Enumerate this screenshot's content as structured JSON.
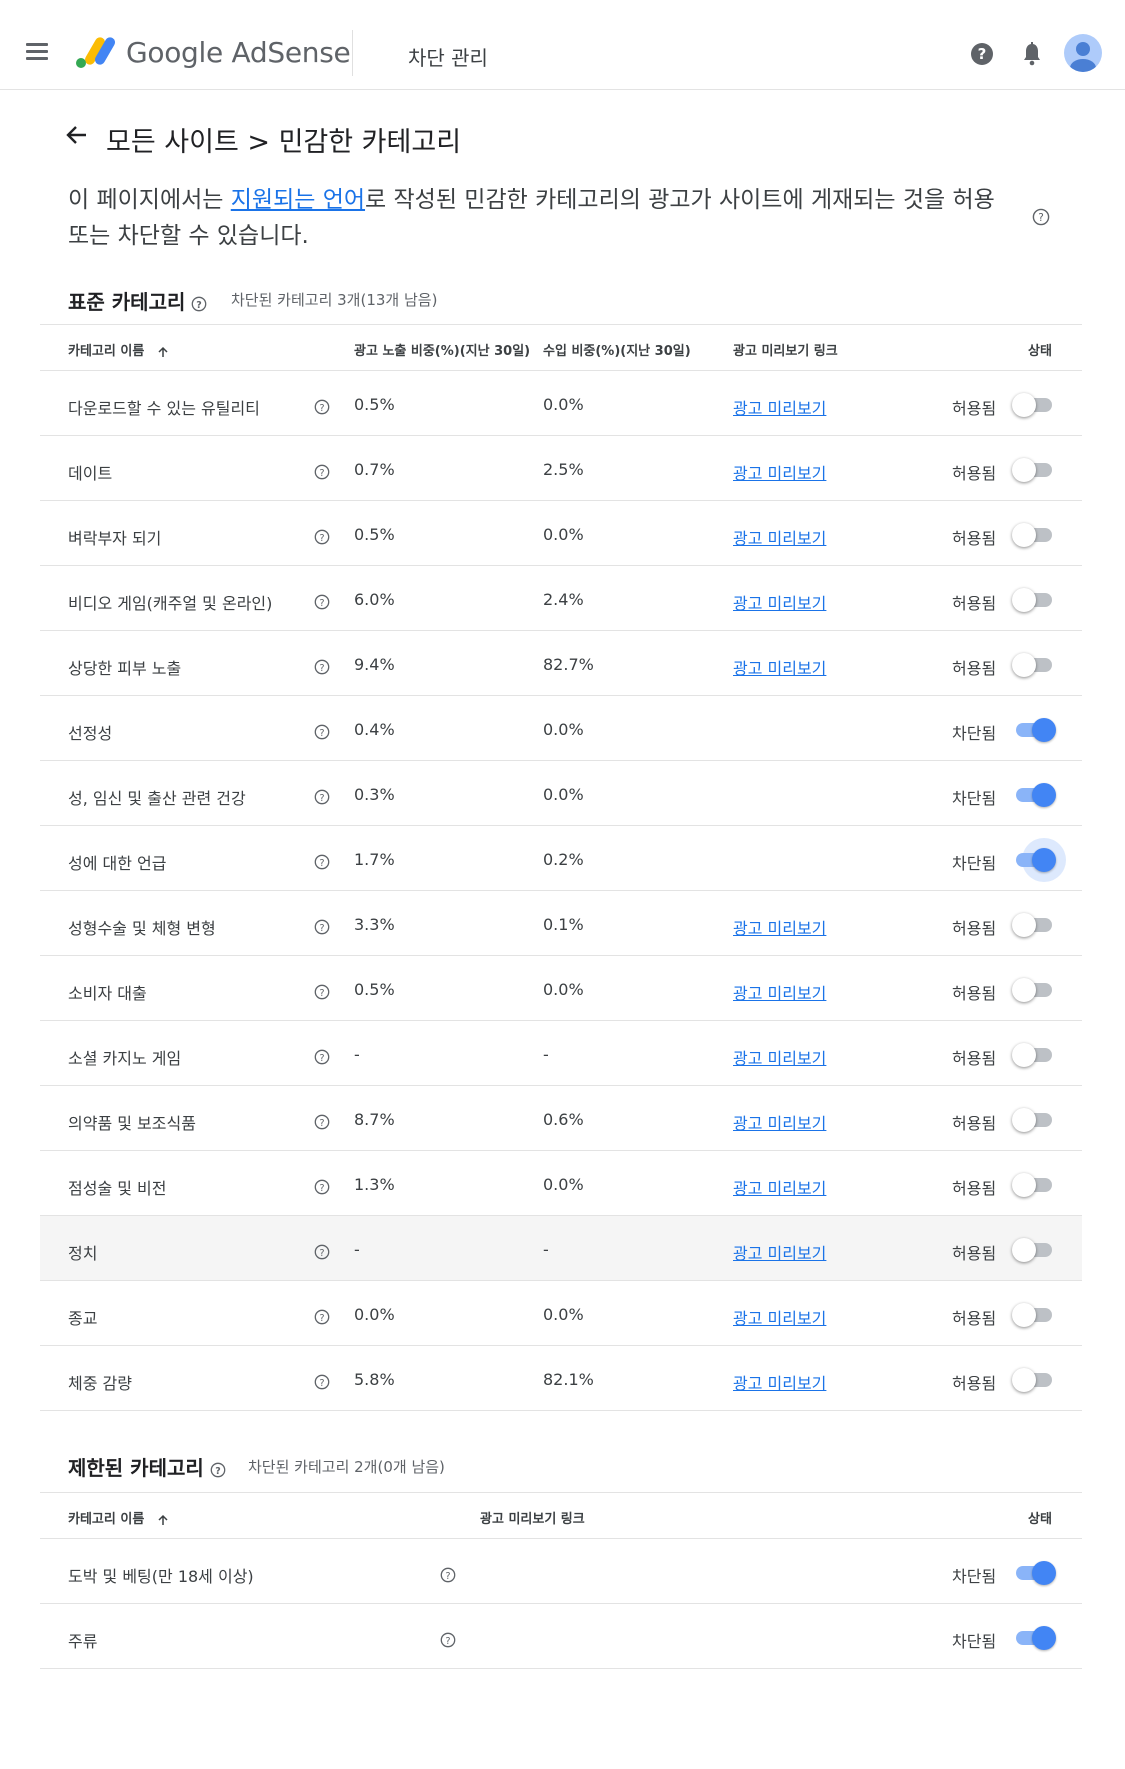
{
  "app": {
    "brand": "Google AdSense",
    "section_title": "차단 관리"
  },
  "breadcrumb": {
    "text": "모든 사이트 > 민감한 카테고리"
  },
  "description": {
    "before": "이 페이지에서는 ",
    "link": "지원되는 언어",
    "after": "로 작성된 민감한 카테고리의 광고가 사이트에 게재되는 것을 허용 또는 차단할 수 있습니다."
  },
  "standard": {
    "title": "표준 카테고리",
    "count": "차단된 카테고리 3개(13개 남음)",
    "headers": {
      "name": "카테고리 이름",
      "impressions": "광고 노출 비중(%)(지난 30일)",
      "revenue": "수입 비중(%)(지난 30일)",
      "preview": "광고 미리보기 링크",
      "status": "상태"
    },
    "rows": [
      {
        "name": "다운로드할 수 있는 유틸리티",
        "imp": "0.5%",
        "rev": "0.0%",
        "link": "광고 미리보기",
        "status": "허용됨",
        "on": false
      },
      {
        "name": "데이트",
        "imp": "0.7%",
        "rev": "2.5%",
        "link": "광고 미리보기",
        "status": "허용됨",
        "on": false
      },
      {
        "name": "벼락부자 되기",
        "imp": "0.5%",
        "rev": "0.0%",
        "link": "광고 미리보기",
        "status": "허용됨",
        "on": false
      },
      {
        "name": "비디오 게임(캐주얼 및 온라인)",
        "imp": "6.0%",
        "rev": "2.4%",
        "link": "광고 미리보기",
        "status": "허용됨",
        "on": false
      },
      {
        "name": "상당한 피부 노출",
        "imp": "9.4%",
        "rev": "82.7%",
        "link": "광고 미리보기",
        "status": "허용됨",
        "on": false
      },
      {
        "name": "선정성",
        "imp": "0.4%",
        "rev": "0.0%",
        "link": "",
        "status": "차단됨",
        "on": true
      },
      {
        "name": "성, 임신 및 출산 관련 건강",
        "imp": "0.3%",
        "rev": "0.0%",
        "link": "",
        "status": "차단됨",
        "on": true
      },
      {
        "name": "성에 대한 언급",
        "imp": "1.7%",
        "rev": "0.2%",
        "link": "",
        "status": "차단됨",
        "on": true,
        "focus": true
      },
      {
        "name": "성형수술 및 체형 변형",
        "imp": "3.3%",
        "rev": "0.1%",
        "link": "광고 미리보기",
        "status": "허용됨",
        "on": false
      },
      {
        "name": "소비자 대출",
        "imp": "0.5%",
        "rev": "0.0%",
        "link": "광고 미리보기",
        "status": "허용됨",
        "on": false
      },
      {
        "name": "소셜 카지노 게임",
        "imp": "-",
        "rev": "-",
        "link": "광고 미리보기",
        "status": "허용됨",
        "on": false
      },
      {
        "name": "의약품 및 보조식품",
        "imp": "8.7%",
        "rev": "0.6%",
        "link": "광고 미리보기",
        "status": "허용됨",
        "on": false
      },
      {
        "name": "점성술 및 비전",
        "imp": "1.3%",
        "rev": "0.0%",
        "link": "광고 미리보기",
        "status": "허용됨",
        "on": false
      },
      {
        "name": "정치",
        "imp": "-",
        "rev": "-",
        "link": "광고 미리보기",
        "status": "허용됨",
        "on": false,
        "hover": true
      },
      {
        "name": "종교",
        "imp": "0.0%",
        "rev": "0.0%",
        "link": "광고 미리보기",
        "status": "허용됨",
        "on": false
      },
      {
        "name": "체중 감량",
        "imp": "5.8%",
        "rev": "82.1%",
        "link": "광고 미리보기",
        "status": "허용됨",
        "on": false
      }
    ]
  },
  "restricted": {
    "title": "제한된 카테고리",
    "count": "차단된 카테고리 2개(0개 남음)",
    "headers": {
      "name": "카테고리 이름",
      "preview": "광고 미리보기 링크",
      "status": "상태"
    },
    "rows": [
      {
        "name": "도박 및 베팅(만 18세 이상)",
        "link": "",
        "status": "차단됨",
        "on": true
      },
      {
        "name": "주류",
        "link": "",
        "status": "차단됨",
        "on": true
      }
    ]
  },
  "colors": {
    "accent": "#4285f4",
    "link": "#1a73e8",
    "avatar_bg": "#aecbfa",
    "avatar_fg": "#4a7fd4"
  },
  "icons": {
    "menu": "menu-icon",
    "logo": "adsense-logo-icon",
    "help": "help-icon",
    "bell": "bell-icon",
    "back": "arrow-back-icon",
    "sort": "arrow-up-icon",
    "info": "question-circle-icon"
  }
}
